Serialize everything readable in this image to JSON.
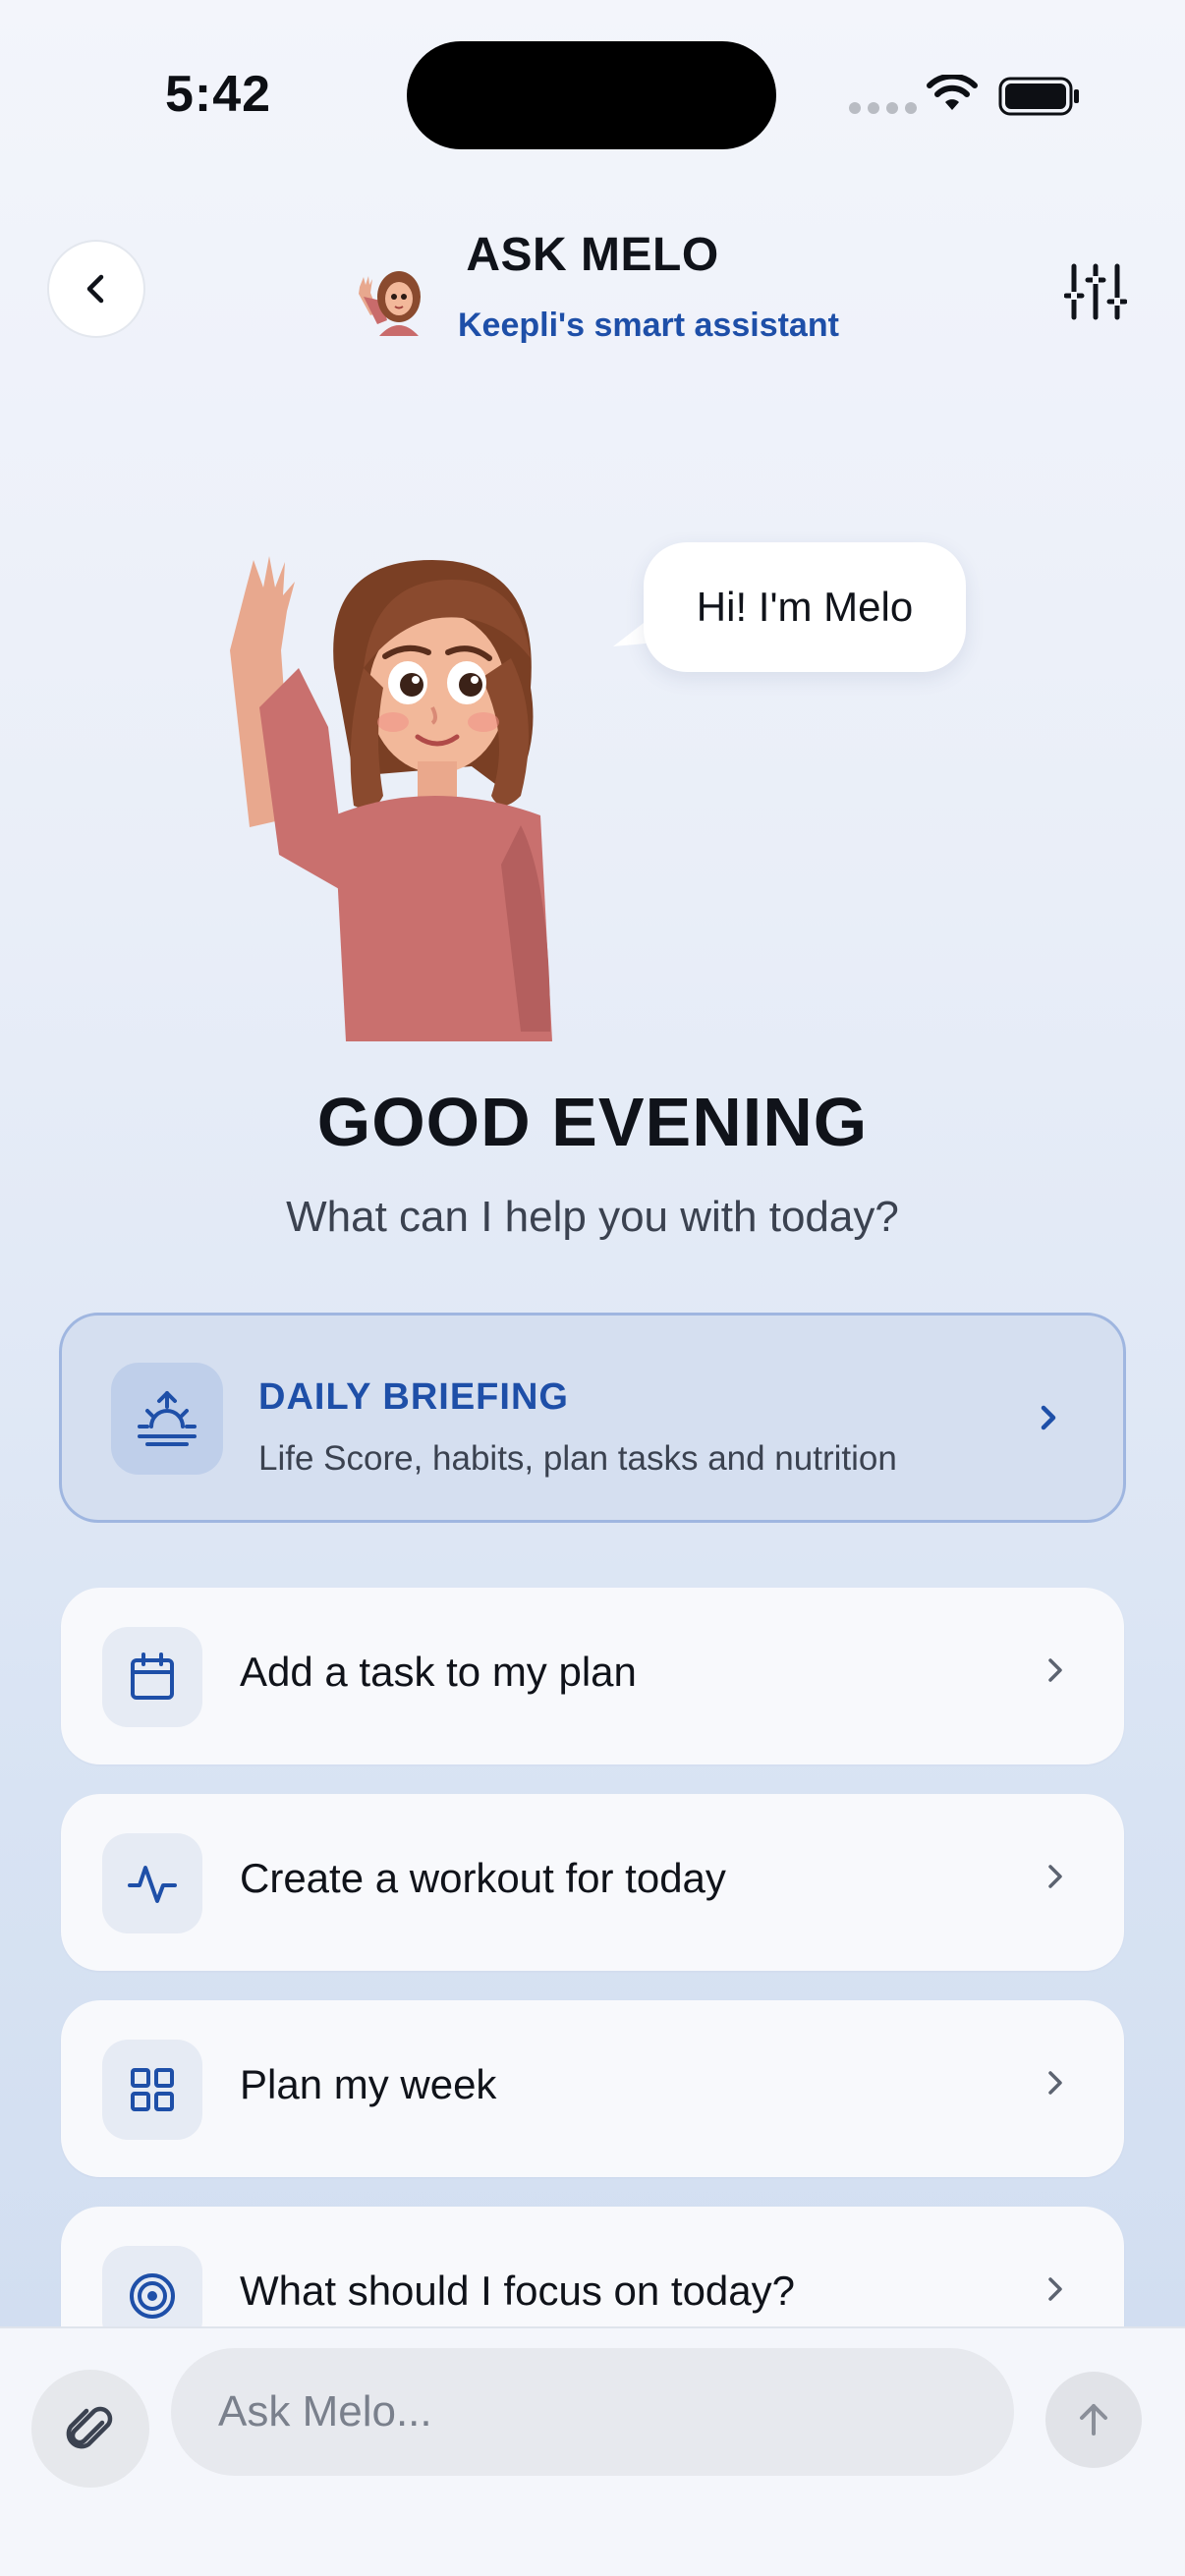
{
  "status_bar": {
    "time": "5:42"
  },
  "header": {
    "title": "ASK MELO",
    "subtitle": "Keepli's smart assistant",
    "back_icon": "chevron-left-icon",
    "settings_icon": "sliders-icon"
  },
  "hero": {
    "speech": "Hi! I'm Melo",
    "greeting": "GOOD EVENING",
    "subgreeting": "What can I help you with today?"
  },
  "briefing": {
    "title": "DAILY BRIEFING",
    "description": "Life Score, habits, plan tasks and nutrition",
    "icon": "sunrise-icon"
  },
  "actions": [
    {
      "label": "Add a task to my plan",
      "icon": "calendar-icon"
    },
    {
      "label": "Create a workout for today",
      "icon": "activity-icon"
    },
    {
      "label": "Plan my week",
      "icon": "grid-icon"
    },
    {
      "label": "What should I focus on today?",
      "icon": "target-icon"
    }
  ],
  "composer": {
    "placeholder": "Ask Melo...",
    "attach_icon": "paperclip-icon",
    "send_icon": "arrow-up-icon"
  },
  "colors": {
    "accent": "#1e4fa8",
    "briefing_bg": "#d5dff0",
    "briefing_border": "#9fb6e0"
  }
}
